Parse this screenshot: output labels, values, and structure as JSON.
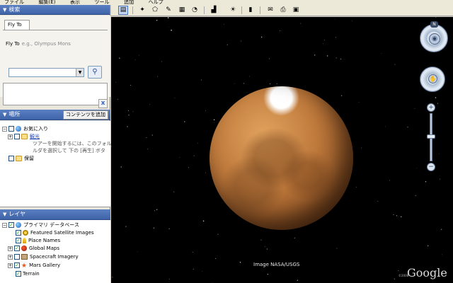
{
  "menu": [
    "ファイル",
    "編集(E)",
    "表示",
    "ツール",
    "追加",
    "ヘルプ"
  ],
  "search": {
    "header": "検索",
    "tab_label": "Fly To",
    "flyto_label": "Fly To",
    "flyto_hint": "e.g., Olympus Mons",
    "input_value": "",
    "search_icon": "magnifier-icon",
    "close_label": "x"
  },
  "places": {
    "header": "場所",
    "add_content": "コンテンツを追加",
    "items": {
      "favorites": "お気に入り",
      "tour": "観光",
      "tour_desc1": "ツアーを開始するには、このフォル",
      "tour_desc2": "ルダを選択して 下の [再生] ボタ",
      "temp": "保留"
    }
  },
  "layers": {
    "header": "レイヤ",
    "primary_db": "プライマリ データベース",
    "items": [
      "Featured Satellite Images",
      "Place Names",
      "Global Maps",
      "Spacecraft Imagery",
      "Mars Gallery",
      "Terrain"
    ]
  },
  "viewport": {
    "credit": "Image NASA/USGS",
    "logo": "Google",
    "copyright": "©2008",
    "compass_north": "N"
  },
  "colors": {
    "panel_header": "#3e63a8",
    "mars": "#bf7a3c",
    "link": "#1a3fb6"
  }
}
